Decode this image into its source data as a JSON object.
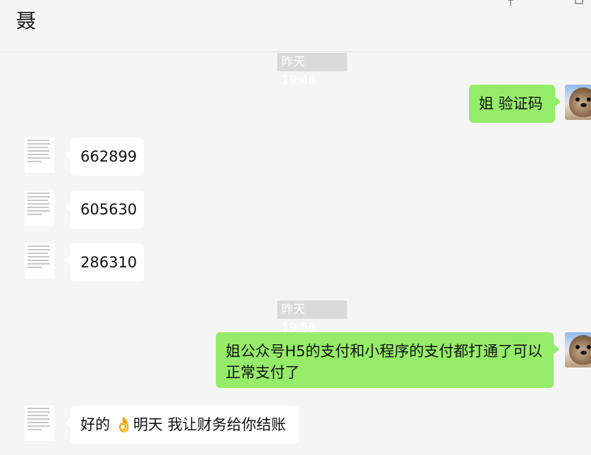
{
  "header": {
    "title": "聂"
  },
  "window_controls": {
    "pin_icon": "pin-icon",
    "minimize_icon": "minimize-icon",
    "maximize_icon": "maximize-icon"
  },
  "messages": [
    {
      "type": "timestamp",
      "text": "昨天 19:46"
    },
    {
      "type": "sent",
      "sender": "me",
      "text": "姐 验证码"
    },
    {
      "type": "received",
      "sender": "other",
      "text": "662899"
    },
    {
      "type": "received",
      "sender": "other",
      "text": "605630"
    },
    {
      "type": "received",
      "sender": "other",
      "text": "286310"
    },
    {
      "type": "timestamp",
      "text": "昨天 19:56"
    },
    {
      "type": "sent",
      "sender": "me",
      "text": "姐公众号H5的支付和小程序的支付都打通了可以正常支付了"
    },
    {
      "type": "received",
      "sender": "other",
      "text": "好的 👌明天 我让财务给你结账"
    }
  ],
  "colors": {
    "background": "#f5f5f5",
    "sent_bubble": "#95ec69",
    "received_bubble": "#ffffff",
    "timestamp_bg": "#dadada"
  }
}
